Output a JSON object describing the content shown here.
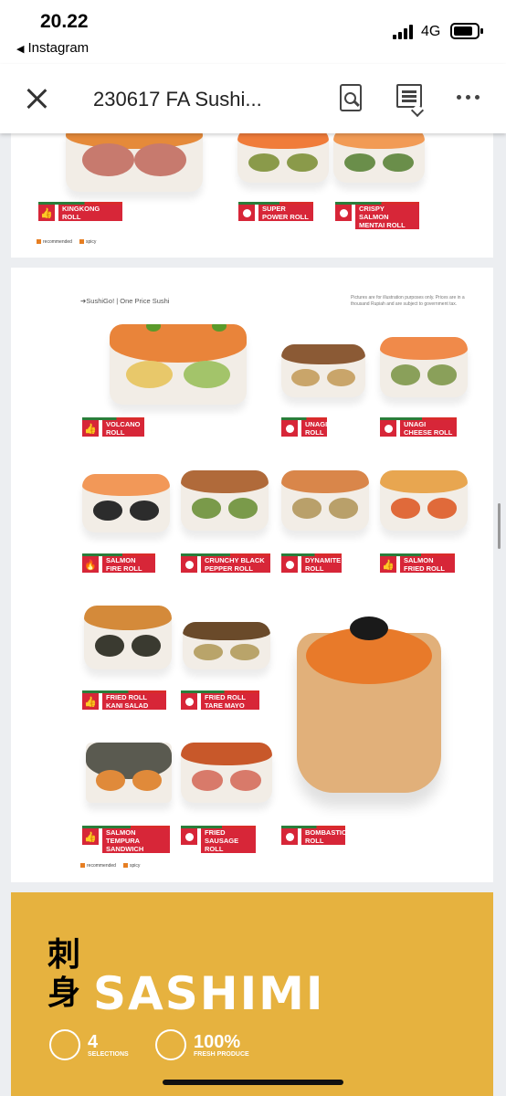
{
  "status_bar": {
    "time": "20.22",
    "back_app": "Instagram",
    "network": "4G"
  },
  "toolbar": {
    "title": "230617  FA Sushi..."
  },
  "page1": {
    "items": [
      {
        "label": "KINGKONG ROLL",
        "icon": "thumb-up-icon"
      },
      {
        "label": "SUPER POWER ROLL",
        "icon": "dot-icon"
      },
      {
        "label": "CRISPY SALMON MENTAI ROLL",
        "icon": "dot-icon"
      }
    ],
    "legend": {
      "recommended": "recommended",
      "spicy": "spicy"
    }
  },
  "page2": {
    "brand": "SushiGo! | One Price Sushi",
    "disclaimer": "Pictures are for illustration purposes only. Prices are in a thousand Rupiah and are subject to government tax.",
    "items": [
      {
        "label": "VOLCANO ROLL",
        "icon": "thumb-up-icon"
      },
      {
        "label": "UNAGI ROLL",
        "icon": "dot-icon"
      },
      {
        "label": "UNAGI CHEESE ROLL",
        "icon": "dot-icon"
      },
      {
        "label": "SALMON FIRE ROLL",
        "icon": "fire-icon"
      },
      {
        "label": "CRUNCHY BLACK PEPPER ROLL",
        "icon": "dot-icon"
      },
      {
        "label": "DYNAMITE ROLL",
        "icon": "dot-icon"
      },
      {
        "label": "SALMON FRIED ROLL",
        "icon": "thumb-up-icon"
      },
      {
        "label": "FRIED ROLL KANI SALAD",
        "icon": "thumb-up-icon"
      },
      {
        "label": "FRIED ROLL TARE MAYO",
        "icon": "dot-icon"
      },
      {
        "label": "SALMON TEMPURA SANDWICH",
        "icon": "thumb-up-icon"
      },
      {
        "label": "FRIED SAUSAGE ROLL",
        "icon": "dot-icon"
      },
      {
        "label": "BOMBASTIC ROLL",
        "icon": "dot-icon"
      }
    ],
    "legend": {
      "recommended": "recommended",
      "spicy": "spicy"
    }
  },
  "page3": {
    "kanji": "刺身",
    "title": "SASHIMI",
    "stats": [
      {
        "number": "4",
        "caption": "SELECTIONS",
        "icon": "chopsticks-icon"
      },
      {
        "number": "100%",
        "caption": "FRESH PRODUCE",
        "icon": "fish-icon"
      }
    ]
  },
  "colors": {
    "label_red": "#d72638",
    "sashimi_yellow": "#e6b23f",
    "stripe_green": "#2a7d3a"
  }
}
